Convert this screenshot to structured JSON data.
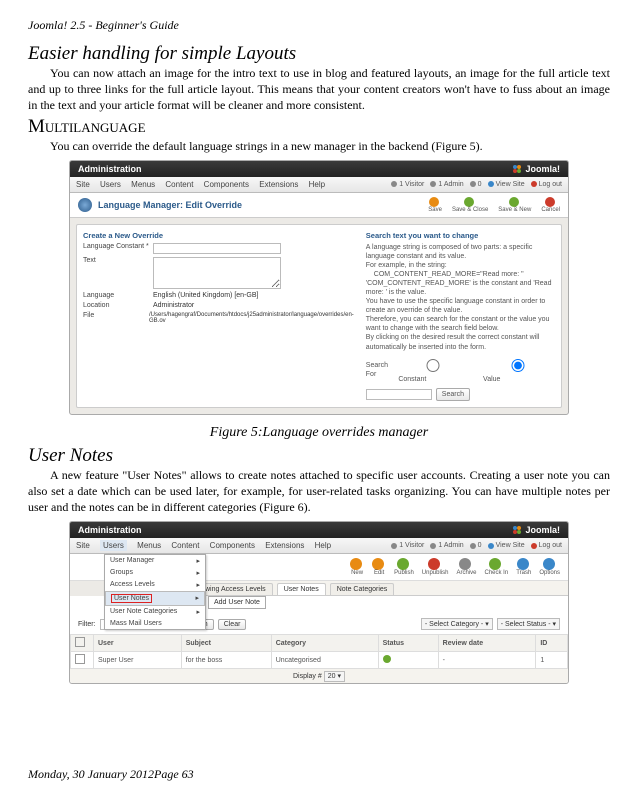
{
  "running_head": "Joomla! 2.5 - Beginner's Guide",
  "s1": {
    "title": "Easier handling for simple Layouts",
    "body": "You can now attach an image for the intro text to use in blog and featured layouts, an image for the full article text and up to three links for the full article layout. This means that your content creators won't have to fuss about an image in the text and your article format will be cleaner and more consistent."
  },
  "s2": {
    "title": "Multilanguage",
    "body": "You can override the default language strings in a new manager in the backend (Figure 5)."
  },
  "fig5": {
    "caption": "Figure 5:Language overrides manager",
    "admin": "Administration",
    "brand": "Joomla!",
    "menu": [
      "Site",
      "Users",
      "Menus",
      "Content",
      "Components",
      "Extensions",
      "Help"
    ],
    "status": {
      "visitor": "1 Visitor",
      "admin": "1 Admin",
      "mail": "0",
      "view": "View Site",
      "logout": "Log out"
    },
    "subtitle": "Language Manager: Edit Override",
    "actions": [
      "Save",
      "Save & Close",
      "Save & New",
      "Cancel"
    ],
    "panel_title": "Create a New Override",
    "fields": {
      "constant": "Language Constant *",
      "text": "Text",
      "language": "Language",
      "language_val": "English (United Kingdom) [en-GB]",
      "location": "Location",
      "location_val": "Administrator",
      "file": "File",
      "file_val": "/Users/hagengraf/Documents/htdocs/j25administrator/language/overrides/en-GB.ov"
    },
    "right": {
      "hdr": "Search text you want to change",
      "p1": "A language string is composed of two parts: a specific language constant and its value.",
      "p2a": "For example, in the string:",
      "p2b": "COM_CONTENT_READ_MORE=\"Read more: \"",
      "p2c": "'COM_CONTENT_READ_MORE' is the constant and 'Read more: ' is the value.",
      "p3": "You have to use the specific language constant in order to create an override of the value.",
      "p4": "Therefore, you can search for the constant or the value you want to change with the search field below.",
      "p5": "By clicking on the desired result the correct constant will automatically be inserted into the form.",
      "searchfor": "Search For",
      "opt_constant": "Constant",
      "opt_value": "Value",
      "search_btn": "Search"
    }
  },
  "s3": {
    "title": "User Notes",
    "body": "A new feature \"User Notes\" allows to create notes attached to specific user accounts. Creating a user note you can also set a date which can be used later, for example, for user-related tasks organizing. You can have multiple notes per user and the notes can be in different categories (Figure 6)."
  },
  "fig6": {
    "admin": "Administration",
    "brand": "Joomla!",
    "menu": [
      "Site",
      "Users",
      "Menus",
      "Content",
      "Components",
      "Extensions",
      "Help"
    ],
    "status": {
      "visitor": "1 Visitor",
      "admin": "1 Admin",
      "mail": "0",
      "view": "View Site",
      "logout": "Log out"
    },
    "dropdown": [
      "User Manager",
      "Groups",
      "Access Levels",
      "User Notes",
      "User Note Categories",
      "Mass Mail Users"
    ],
    "dropdown_sub": "Add User Note",
    "tabs": [
      "Viewing Access Levels",
      "User Notes",
      "Note Categories"
    ],
    "toolbar": [
      "New",
      "Edit",
      "Publish",
      "Unpublish",
      "Archive",
      "Check In",
      "Trash",
      "Options"
    ],
    "filter_label": "Filter:",
    "search": "Search",
    "clear": "Clear",
    "selects": [
      "- Select Category -",
      "- Select Status -"
    ],
    "cols": [
      "",
      "User",
      "Subject",
      "Category",
      "Status",
      "Review date",
      "ID"
    ],
    "row": {
      "user": "Super User",
      "subject": "for the boss",
      "category": "Uncategorised",
      "id": "1"
    },
    "display": "Display #",
    "display_n": "20"
  },
  "footer": {
    "date": "Monday, 30 January 2012",
    "page": "Page 63"
  }
}
